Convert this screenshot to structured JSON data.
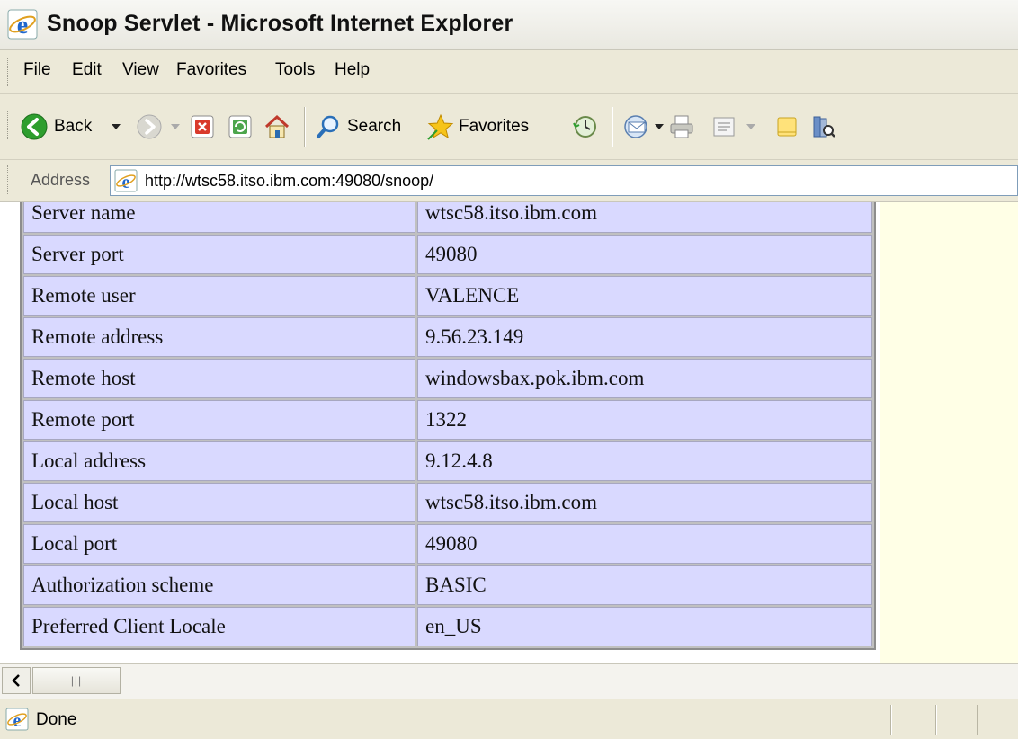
{
  "window": {
    "title": "Snoop Servlet - Microsoft Internet Explorer"
  },
  "menu": {
    "items": [
      {
        "label": "File",
        "accesskey": "F",
        "rest": "ile"
      },
      {
        "label": "Edit",
        "accesskey": "E",
        "rest": "dit"
      },
      {
        "label": "View",
        "accesskey": "V",
        "rest": "iew"
      },
      {
        "label": "Favorites",
        "accesskey": "a",
        "pre": "F",
        "rest": "vorites"
      },
      {
        "label": "Tools",
        "accesskey": "T",
        "rest": "ools"
      },
      {
        "label": "Help",
        "accesskey": "H",
        "rest": "elp"
      }
    ]
  },
  "toolbar": {
    "back_label": "Back",
    "search_label": "Search",
    "favorites_label": "Favorites"
  },
  "address": {
    "label": "Address",
    "url": "http://wtsc58.itso.ibm.com:49080/snoop/"
  },
  "table": {
    "rows": [
      [
        "Server name",
        "wtsc58.itso.ibm.com"
      ],
      [
        "Server port",
        "49080"
      ],
      [
        "Remote user",
        "VALENCE"
      ],
      [
        "Remote address",
        "9.56.23.149"
      ],
      [
        "Remote host",
        "windowsbax.pok.ibm.com"
      ],
      [
        "Remote port",
        "1322"
      ],
      [
        "Local address",
        "9.12.4.8"
      ],
      [
        "Local host",
        "wtsc58.itso.ibm.com"
      ],
      [
        "Local port",
        "49080"
      ],
      [
        "Authorization scheme",
        "BASIC"
      ],
      [
        "Preferred Client Locale",
        "en_US"
      ]
    ]
  },
  "status": {
    "text": "Done"
  },
  "icons": [
    "ie-icon",
    "back-icon",
    "forward-icon",
    "stop-icon",
    "refresh-icon",
    "home-icon",
    "search-icon",
    "favorites-star-icon",
    "history-icon",
    "mail-icon",
    "print-icon",
    "edit-icon",
    "discuss-icon",
    "research-icon"
  ],
  "colors": {
    "chrome": "#ece9d8",
    "cell": "#d9d9ff",
    "page_bg": "#ffffe6",
    "back_green": "#2e9e2e"
  }
}
